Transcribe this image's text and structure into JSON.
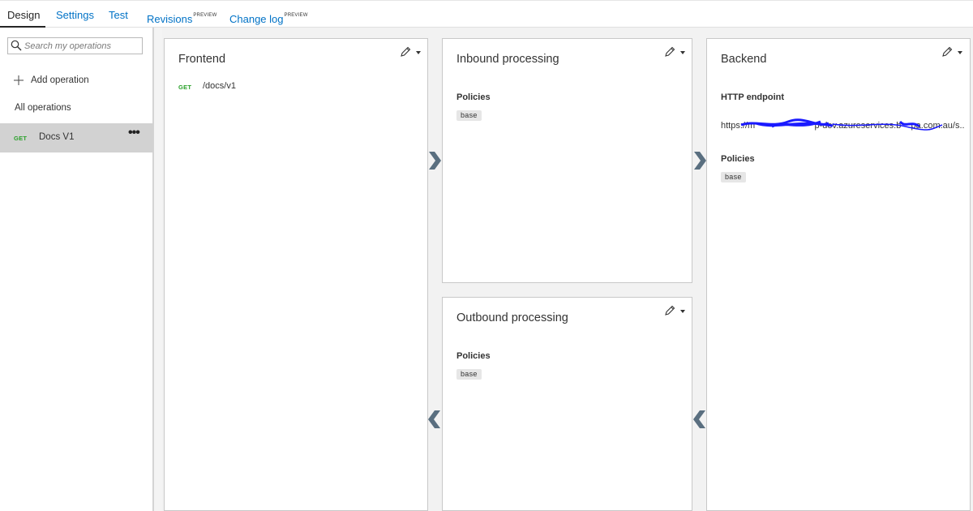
{
  "tabs": [
    {
      "label": "Design",
      "active": true,
      "sup": ""
    },
    {
      "label": "Settings",
      "active": false,
      "sup": ""
    },
    {
      "label": "Test",
      "active": false,
      "sup": ""
    },
    {
      "label": "Revisions",
      "active": false,
      "sup": "PREVIEW"
    },
    {
      "label": "Change log",
      "active": false,
      "sup": "PREVIEW"
    }
  ],
  "sidebar": {
    "search_placeholder": "Search my operations",
    "add_operation": "Add operation",
    "all_operations": "All operations",
    "operations": [
      {
        "method": "GET",
        "name": "Docs V1",
        "more": "•••"
      }
    ]
  },
  "frontend": {
    "title": "Frontend",
    "method": "GET",
    "path": "/docs/v1"
  },
  "inbound": {
    "title": "Inbound processing",
    "policies_label": "Policies",
    "policy": "base"
  },
  "outbound": {
    "title": "Outbound processing",
    "policies_label": "Policies",
    "policy": "base"
  },
  "backend": {
    "title": "Backend",
    "endpoint_label": "HTTP endpoint",
    "endpoint_value": "https://m                        p-dev.azureservices.b    pa.com.au/s...",
    "policies_label": "Policies",
    "policy": "base"
  },
  "colors": {
    "accent": "#0072c6",
    "get_method": "#2aa12a",
    "arrow": "#5a6f80",
    "redaction": "#1a1aff"
  },
  "icons": {
    "search": "search-icon",
    "add": "plus-icon",
    "edit": "pencil-icon",
    "flow_forward": "chevron-right-icon",
    "flow_back": "chevron-left-icon"
  }
}
